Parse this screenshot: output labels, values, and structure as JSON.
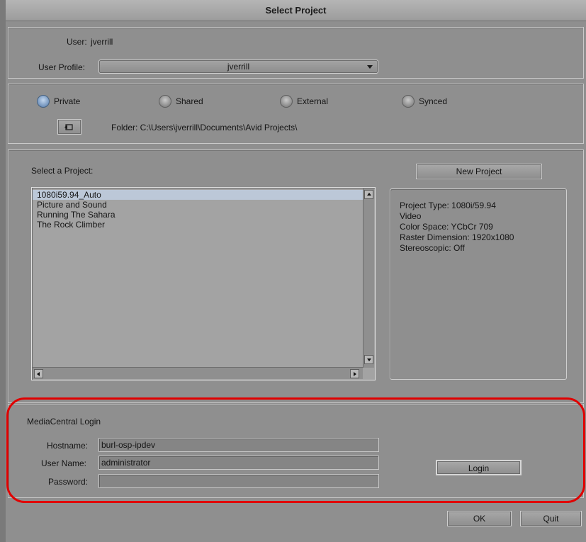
{
  "window": {
    "title": "Select Project"
  },
  "user": {
    "label": "User:",
    "value": "jverrill",
    "profile_label": "User Profile:",
    "profile_value": "jverrill"
  },
  "location": {
    "options": [
      {
        "label": "Private",
        "selected": true
      },
      {
        "label": "Shared",
        "selected": false
      },
      {
        "label": "External",
        "selected": false
      },
      {
        "label": "Synced",
        "selected": false
      }
    ],
    "folder_text": "Folder: C:\\Users\\jverrill\\Documents\\Avid Projects\\",
    "browse_icon": "folder-browse-icon"
  },
  "projects": {
    "label": "Select a Project:",
    "new_button": "New Project",
    "items": [
      "1080i59.94_Auto",
      "Picture and Sound",
      "Running The Sahara",
      "The Rock Climber"
    ],
    "selected_index": 0
  },
  "info": {
    "lines": [
      "Project Type: 1080i/59.94",
      "Video",
      "Color Space: YCbCr 709",
      "Raster Dimension: 1920x1080",
      "Stereoscopic: Off"
    ]
  },
  "login": {
    "section_title": "MediaCentral Login",
    "hostname_label": "Hostname:",
    "hostname_value": "burl-osp-ipdev",
    "username_label": "User Name:",
    "username_value": "administrator",
    "password_label": "Password:",
    "password_value": "",
    "login_button": "Login"
  },
  "footer": {
    "ok": "OK",
    "quit": "Quit"
  },
  "colors": {
    "highlight": "#e00000",
    "selection": "#bcc8d8",
    "radio_on": "#6d8fb9"
  }
}
